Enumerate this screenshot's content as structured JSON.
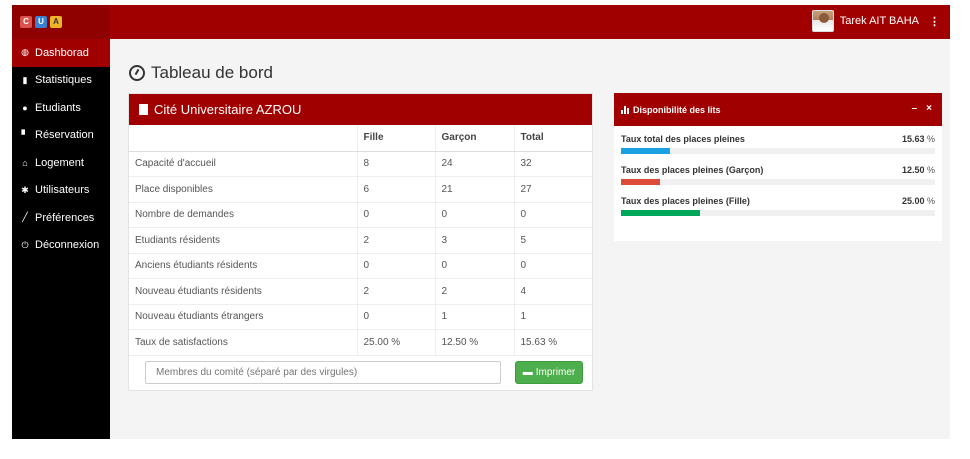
{
  "app": {
    "logo": [
      "C",
      "U",
      "A"
    ]
  },
  "user": {
    "name": "Tarek AIT BAHA",
    "menu_icon": "⋮"
  },
  "sidebar": {
    "items": [
      {
        "label": "Dashborad",
        "icon": "dashboard-icon",
        "active": true
      },
      {
        "label": "Statistiques",
        "icon": "bar-chart-icon",
        "active": false
      },
      {
        "label": "Etudiants",
        "icon": "user-icon",
        "active": false
      },
      {
        "label": "Réservation",
        "icon": "document-icon",
        "active": false
      },
      {
        "label": "Logement",
        "icon": "home-icon",
        "active": false
      },
      {
        "label": "Utilisateurs",
        "icon": "gear-icon",
        "active": false
      },
      {
        "label": "Préférences",
        "icon": "wrench-icon",
        "active": false
      },
      {
        "label": "Déconnexion",
        "icon": "power-icon",
        "active": false
      }
    ]
  },
  "page": {
    "title": "Tableau de bord"
  },
  "main_box": {
    "title": "Cité Universitaire AZROU",
    "columns": [
      "",
      "Fille",
      "Garçon",
      "Total"
    ],
    "rows": [
      [
        "Capacité d'accueil",
        "8",
        "24",
        "32"
      ],
      [
        "Place disponibles",
        "6",
        "21",
        "27"
      ],
      [
        "Nombre de demandes",
        "0",
        "0",
        "0"
      ],
      [
        "Etudiants résidents",
        "2",
        "3",
        "5"
      ],
      [
        "Anciens étudiants résidents",
        "0",
        "0",
        "0"
      ],
      [
        "Nouveau étudiants résidents",
        "2",
        "2",
        "4"
      ],
      [
        "Nouveau étudiants étrangers",
        "0",
        "1",
        "1"
      ],
      [
        "Taux de satisfactions",
        "25.00 %",
        "12.50 %",
        "15.63 %"
      ]
    ],
    "comite_placeholder": "Membres du comité (séparé par des virgules)",
    "print_label": "Imprimer"
  },
  "availability": {
    "title": "Disponibilité des lits",
    "minimize": "–",
    "close": "×",
    "items": [
      {
        "label": "Taux total des places pleines",
        "value": "15.63",
        "unit": "%",
        "percent": 15.63,
        "color": "#1ba1e2"
      },
      {
        "label": "Taux des places pleines (Garçon)",
        "value": "12.50",
        "unit": "%",
        "percent": 12.5,
        "color": "#dd4b39"
      },
      {
        "label": "Taux des places pleines (Fille)",
        "value": "25.00",
        "unit": "%",
        "percent": 25.0,
        "color": "#00a65a"
      }
    ]
  }
}
